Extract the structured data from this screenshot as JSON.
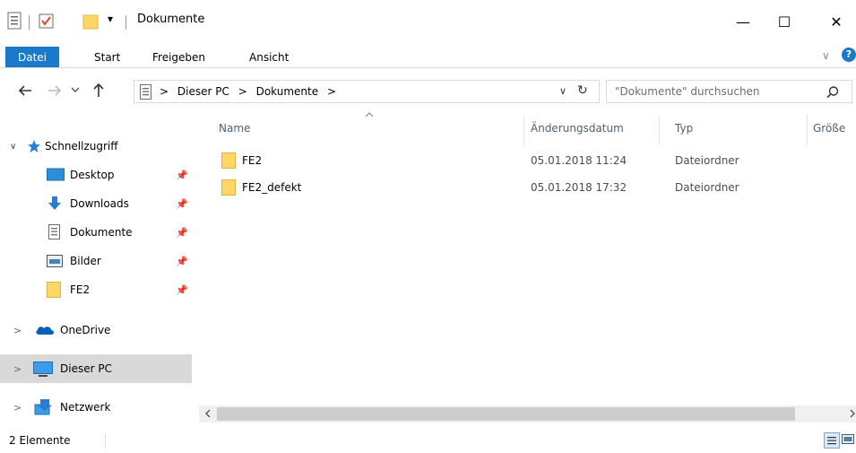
{
  "window": {
    "title": "Dokumente",
    "quick_access_dropdown": "▾",
    "minimize_glyph": "—",
    "maximize_glyph": "☐",
    "close_glyph": "✕"
  },
  "ribbon": {
    "tabs": [
      "Datei",
      "Start",
      "Freigeben",
      "Ansicht"
    ],
    "expand_glyph": "∨",
    "help_glyph": "?"
  },
  "address": {
    "breadcrumb": [
      ">",
      "Dieser PC",
      ">",
      "Dokumente",
      ">"
    ],
    "dropdown_glyph": "∨",
    "refresh_glyph": "↻",
    "search_placeholder": "\"Dokumente\" durchsuchen"
  },
  "nav": {
    "quick_access": {
      "label": "Schnellzugriff",
      "expand_glyph": "∨",
      "items": [
        {
          "label": "Desktop",
          "icon": "desktop-icon"
        },
        {
          "label": "Downloads",
          "icon": "download-arrow-icon"
        },
        {
          "label": "Dokumente",
          "icon": "document-icon"
        },
        {
          "label": "Bilder",
          "icon": "pictures-icon"
        },
        {
          "label": "FE2",
          "icon": "folder-icon"
        }
      ]
    },
    "onedrive": {
      "label": "OneDrive",
      "expand_glyph": ">"
    },
    "this_pc": {
      "label": "Dieser PC",
      "expand_glyph": ">"
    },
    "network": {
      "label": "Netzwerk",
      "expand_glyph": ">"
    }
  },
  "columns": [
    "Name",
    "Änderungsdatum",
    "Typ",
    "Größe"
  ],
  "files": [
    {
      "name": "FE2",
      "modified": "05.01.2018 11:24",
      "type": "Dateiordner"
    },
    {
      "name": "FE2_defekt",
      "modified": "05.01.2018 17:32",
      "type": "Dateiordner"
    }
  ],
  "status": {
    "count": "2 Elemente"
  },
  "colors": {
    "accent": "#1979ca",
    "folder": "#ffd767",
    "selection": "#d9d9d9"
  }
}
